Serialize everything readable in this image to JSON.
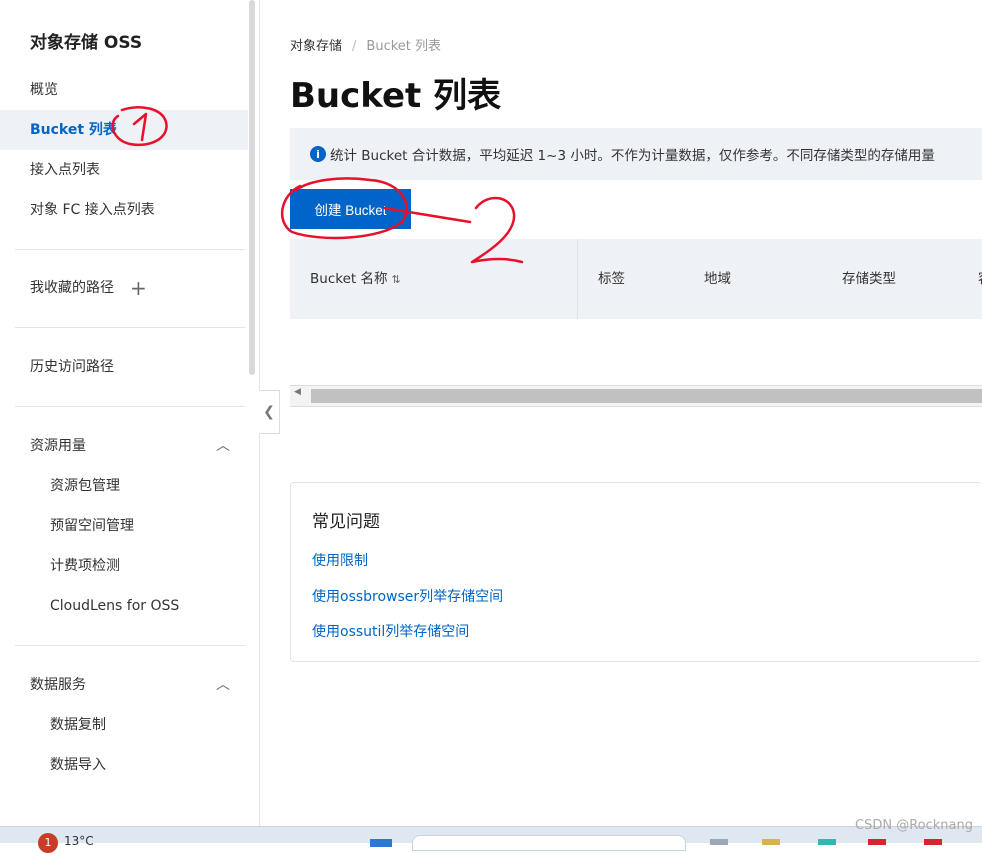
{
  "sidebar": {
    "title": "对象存储 OSS",
    "items": {
      "overview": "概览",
      "bucket_list": "Bucket 列表",
      "access_points": "接入点列表",
      "fc_access_points": "对象 FC 接入点列表",
      "favorites": "我收藏的路径",
      "history": "历史访问路径",
      "resource_usage": "资源用量",
      "resource_pack": "资源包管理",
      "reserved_space": "预留空间管理",
      "billing_check": "计费项检测",
      "cloudlens": "CloudLens for OSS",
      "data_services": "数据服务",
      "data_replication": "数据复制",
      "data_import": "数据导入"
    }
  },
  "breadcrumb": {
    "root": "对象存储",
    "separator": "/",
    "current": "Bucket 列表"
  },
  "page_title": "Bucket 列表",
  "info_bar": {
    "icon": "i",
    "text": "统计 Bucket 合计数据，平均延迟 1~3 小时。不作为计量数据，仅作参考。不同存储类型的存储用量"
  },
  "create_button": "创建 Bucket",
  "table": {
    "columns": [
      "Bucket 名称",
      "标签",
      "地域",
      "存储类型",
      "容"
    ]
  },
  "faq": {
    "title": "常见问题",
    "links": [
      "使用限制",
      "使用ossbrowser列举存储空间",
      "使用ossutil列举存储空间"
    ]
  },
  "taskbar": {
    "badge": "1",
    "temperature": "13°C"
  },
  "watermark": "CSDN @Rocknang",
  "colors": {
    "accent": "#0064c8",
    "annotation": "#e8102a",
    "panel_bg": "#eef1f6"
  }
}
